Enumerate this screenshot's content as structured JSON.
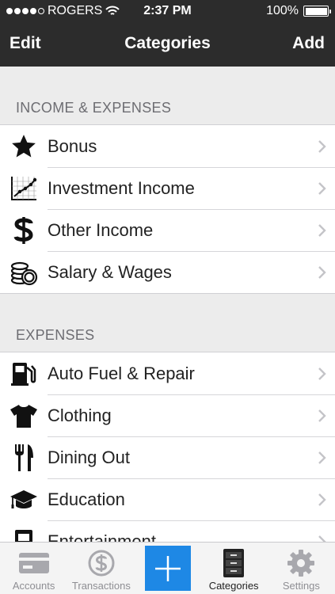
{
  "status_bar": {
    "carrier": "ROGERS",
    "time": "2:37 PM",
    "battery": "100%"
  },
  "nav": {
    "left_button": "Edit",
    "title": "Categories",
    "right_button": "Add"
  },
  "sections": [
    {
      "header": "INCOME & EXPENSES",
      "items": [
        {
          "label": "Bonus",
          "icon": "star-icon"
        },
        {
          "label": "Investment Income",
          "icon": "line-chart-icon"
        },
        {
          "label": "Other Income",
          "icon": "dollar-icon"
        },
        {
          "label": "Salary & Wages",
          "icon": "coins-icon"
        }
      ]
    },
    {
      "header": "EXPENSES",
      "items": [
        {
          "label": "Auto Fuel & Repair",
          "icon": "fuel-pump-icon"
        },
        {
          "label": "Clothing",
          "icon": "tshirt-icon"
        },
        {
          "label": "Dining Out",
          "icon": "utensils-icon"
        },
        {
          "label": "Education",
          "icon": "graduation-cap-icon"
        },
        {
          "label": "Entertainment",
          "icon": "film-icon"
        }
      ]
    }
  ],
  "tabs": [
    {
      "label": "Accounts",
      "icon": "credit-card-icon"
    },
    {
      "label": "Transactions",
      "icon": "dollar-circle-icon"
    },
    {
      "label": "",
      "icon": "plus-icon"
    },
    {
      "label": "Categories",
      "icon": "cabinet-icon"
    },
    {
      "label": "Settings",
      "icon": "gear-icon"
    }
  ],
  "colors": {
    "bar": "#2c2c2c",
    "accent": "#1e88e5",
    "background": "#ececec"
  }
}
